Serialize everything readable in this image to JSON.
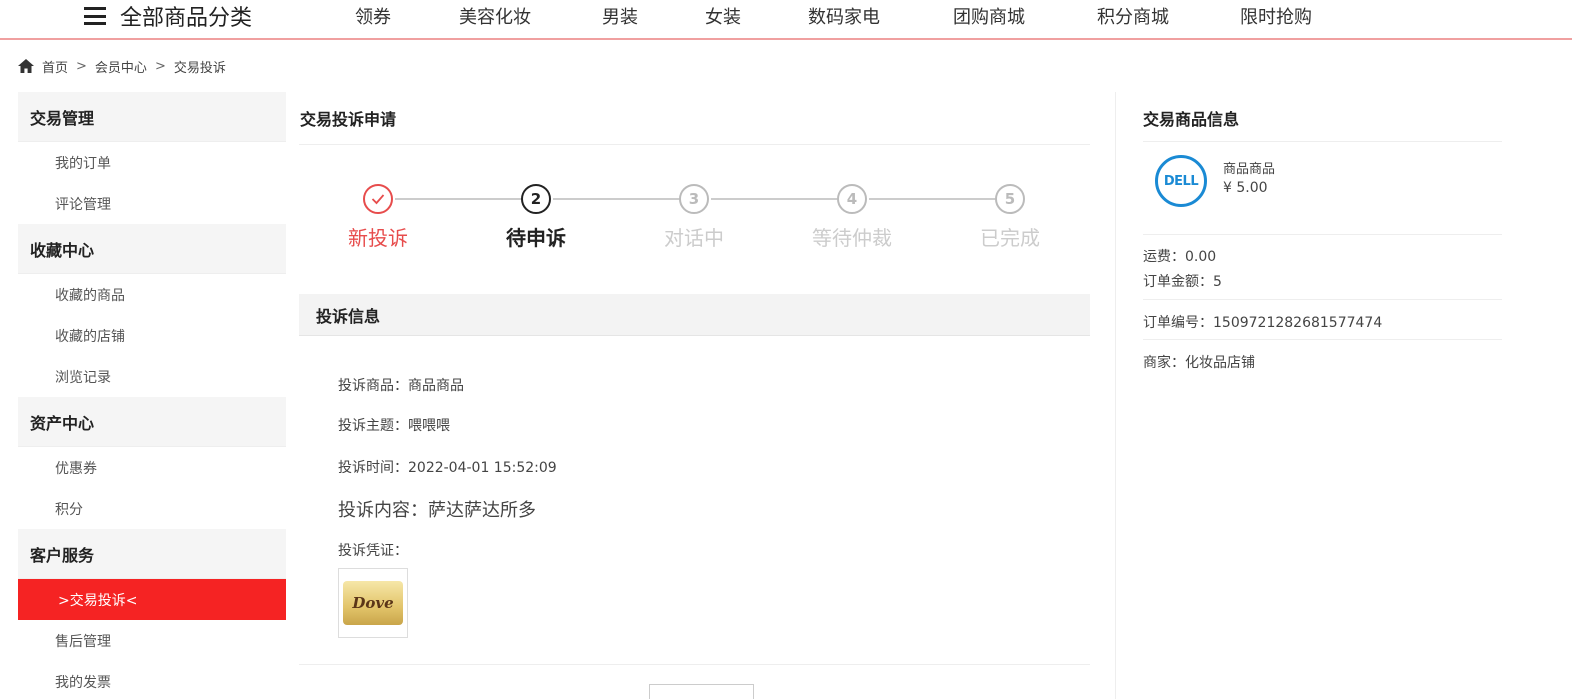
{
  "topnav": {
    "all_categories": "全部商品分类",
    "links": [
      "领券",
      "美容化妆",
      "男装",
      "女装",
      "数码家电",
      "团购商城",
      "积分商城",
      "限时抢购"
    ]
  },
  "breadcrumb": [
    "首页",
    "会员中心",
    "交易投诉"
  ],
  "breadcrumb_sep": ">",
  "sidebar": {
    "groups": [
      {
        "title": "交易管理",
        "items": [
          "我的订单",
          "评论管理"
        ]
      },
      {
        "title": "收藏中心",
        "items": [
          "收藏的商品",
          "收藏的店铺",
          "浏览记录"
        ]
      },
      {
        "title": "资产中心",
        "items": [
          "优惠券",
          "积分"
        ]
      },
      {
        "title": "客户服务",
        "items": [
          ">交易投诉<",
          "售后管理",
          "我的发票"
        ]
      }
    ],
    "active_item": ">交易投诉<"
  },
  "complaint": {
    "title": "交易投诉申请",
    "steps": [
      {
        "label": "新投诉",
        "num": "",
        "state": "done"
      },
      {
        "label": "待申诉",
        "num": "2",
        "state": "current"
      },
      {
        "label": "对话中",
        "num": "3",
        "state": "todo"
      },
      {
        "label": "等待仲裁",
        "num": "4",
        "state": "todo"
      },
      {
        "label": "已完成",
        "num": "5",
        "state": "todo"
      }
    ],
    "info_title": "投诉信息",
    "product_label": "投诉商品：",
    "product_value": "商品商品",
    "subject_label": "投诉主题：",
    "subject_value": "喂喂喂",
    "time_label": "投诉时间：",
    "time_value": "2022-04-01 15:52:09",
    "content_label": "投诉内容：",
    "content_value": "萨达萨达所多",
    "evidence_label": "投诉凭证：",
    "evidence_brand": "Dove"
  },
  "order_info": {
    "title": "交易商品信息",
    "product_name": "商品商品",
    "product_price": "¥ 5.00",
    "brand_logo": "DELL",
    "shipping_label": "运费：",
    "shipping_value": "0.00",
    "amount_label": "订单金额：",
    "amount_value": "5",
    "order_no_label": "订单编号：",
    "order_no_value": "1509721282681577474",
    "seller_label": "商家：",
    "seller_value": "化妆品店铺"
  },
  "colors": {
    "accent": "#f52323",
    "step_done": "#e74c4c",
    "dell_blue": "#1a8ad4"
  }
}
